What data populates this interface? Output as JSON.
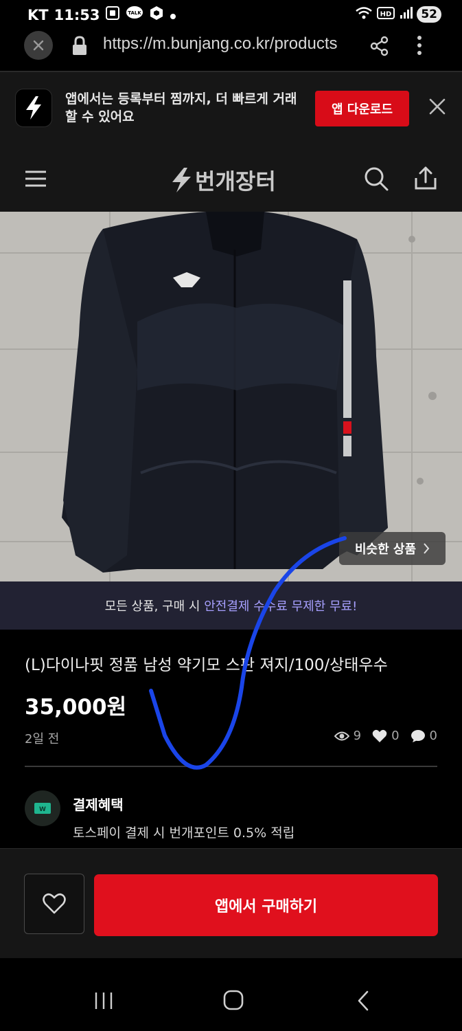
{
  "status_bar": {
    "carrier": "KT",
    "time": "11:53",
    "notification_icons": [
      "screenshot-icon",
      "kakaotalk-icon",
      "box-icon",
      "dot-icon"
    ],
    "talk_label": "TALK",
    "network_label": "HD",
    "battery": "52"
  },
  "browser": {
    "url": "https://m.bunjang.co.kr/products"
  },
  "app_banner": {
    "text": "앱에서는 등록부터 찜까지, 더 빠르게 거래할 수 있어요",
    "download_label": "앱 다운로드"
  },
  "nav": {
    "brand_name": "번개장터"
  },
  "product": {
    "similar_label": "비슷한 상품",
    "promo_prefix": "모든 상품, 구매 시 ",
    "promo_highlight": "안전결제 수수료 무제한 무료!",
    "title": "(L)다이나핏 정품 남성 약기모 스판 져지/100/상태우수",
    "price": "35,000원",
    "time_ago": "2일 전",
    "views": "9",
    "likes": "0",
    "chats": "0"
  },
  "benefit": {
    "title": "결제혜택",
    "description": "토스페이 결제 시 번개포인트 0.5% 적립",
    "icon_label": "W"
  },
  "actions": {
    "buy_label": "앱에서 구매하기"
  },
  "colors": {
    "accent_red": "#e0101d",
    "promo_highlight": "#a7a0ff",
    "promo_bg": "#222233"
  }
}
